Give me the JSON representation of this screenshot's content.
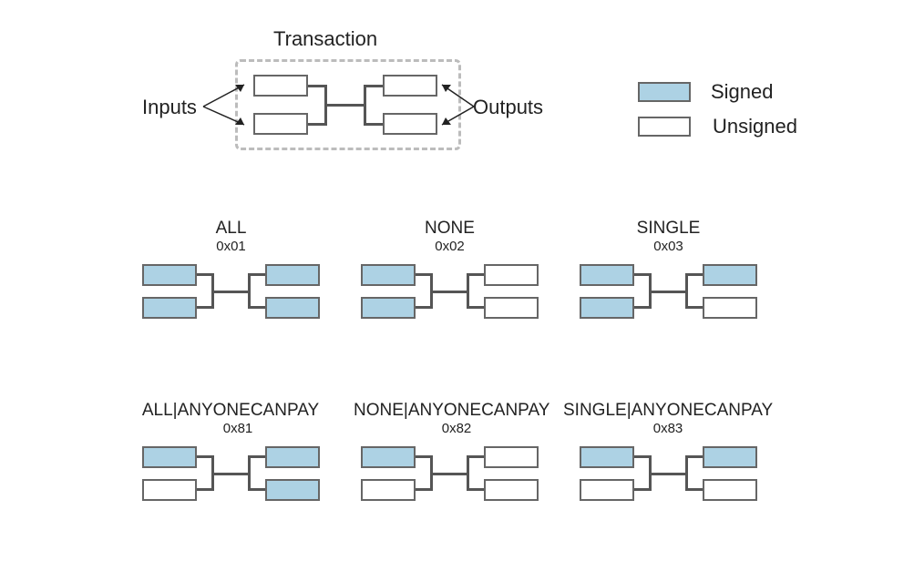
{
  "transaction_label": "Transaction",
  "inputs_label": "Inputs",
  "outputs_label": "Outputs",
  "legend": {
    "signed": "Signed",
    "unsigned": "Unsigned"
  },
  "types": {
    "all": {
      "name": "ALL",
      "code": "0x01",
      "in": [
        "signed",
        "signed"
      ],
      "out": [
        "signed",
        "signed"
      ]
    },
    "none": {
      "name": "NONE",
      "code": "0x02",
      "in": [
        "signed",
        "signed"
      ],
      "out": [
        "unsigned",
        "unsigned"
      ]
    },
    "single": {
      "name": "SINGLE",
      "code": "0x03",
      "in": [
        "signed",
        "signed"
      ],
      "out": [
        "signed",
        "unsigned"
      ]
    },
    "all_acp": {
      "name": "ALL|ANYONECANPAY",
      "code": "0x81",
      "in": [
        "signed",
        "unsigned"
      ],
      "out": [
        "signed",
        "signed"
      ]
    },
    "none_acp": {
      "name": "NONE|ANYONECANPAY",
      "code": "0x82",
      "in": [
        "signed",
        "unsigned"
      ],
      "out": [
        "unsigned",
        "unsigned"
      ]
    },
    "single_acp": {
      "name": "SINGLE|ANYONECANPAY",
      "code": "0x83",
      "in": [
        "signed",
        "unsigned"
      ],
      "out": [
        "signed",
        "unsigned"
      ]
    }
  },
  "colors": {
    "signed_fill": "#add2e4",
    "stroke": "#666666",
    "connector": "#555555",
    "dashed": "#bcbcbc"
  }
}
